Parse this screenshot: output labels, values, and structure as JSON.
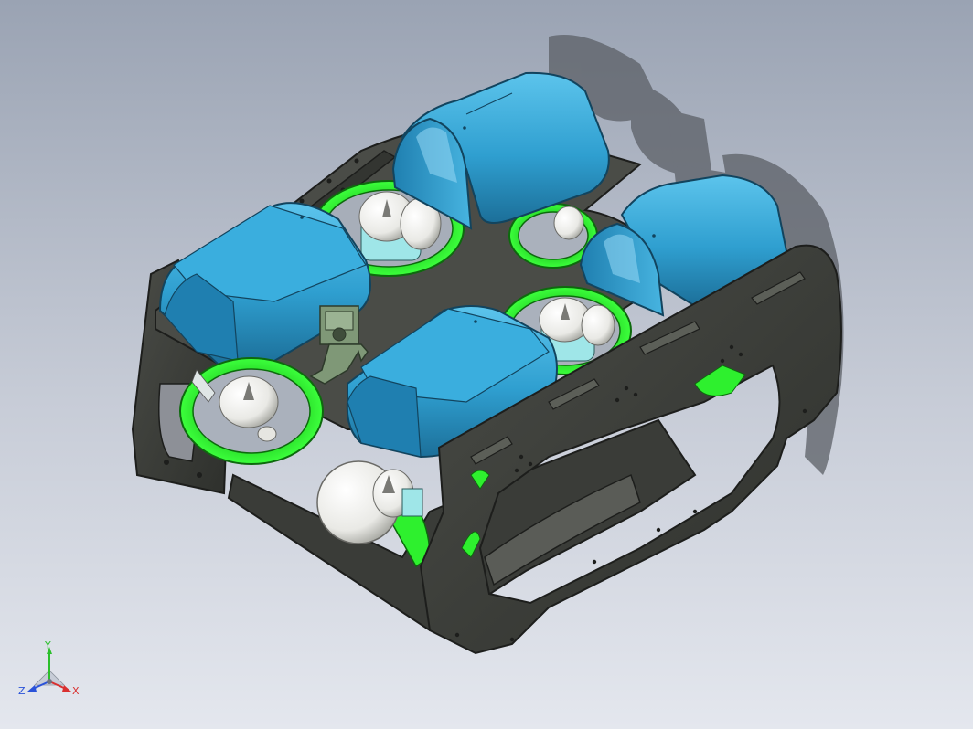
{
  "viewport": {
    "background_top": "#9aa3b3",
    "background_bottom": "#e4e7ee"
  },
  "model": {
    "frame_color": "#3d3f3b",
    "frame_edge_color": "#1d1e1c",
    "float_color": "#2f9fd0",
    "float_highlight": "#5cc4ec",
    "thruster_ring_color": "#2ef02e",
    "thruster_hub_color": "#f3f3f1",
    "camera_color": "#7f9877",
    "shadow_color": "#5b5f66"
  },
  "triad": {
    "y_label": "Y",
    "z_label": "Z",
    "x_label": "X",
    "y_color": "#2bbf2b",
    "z_color": "#2a52d9",
    "x_color": "#d93030"
  }
}
